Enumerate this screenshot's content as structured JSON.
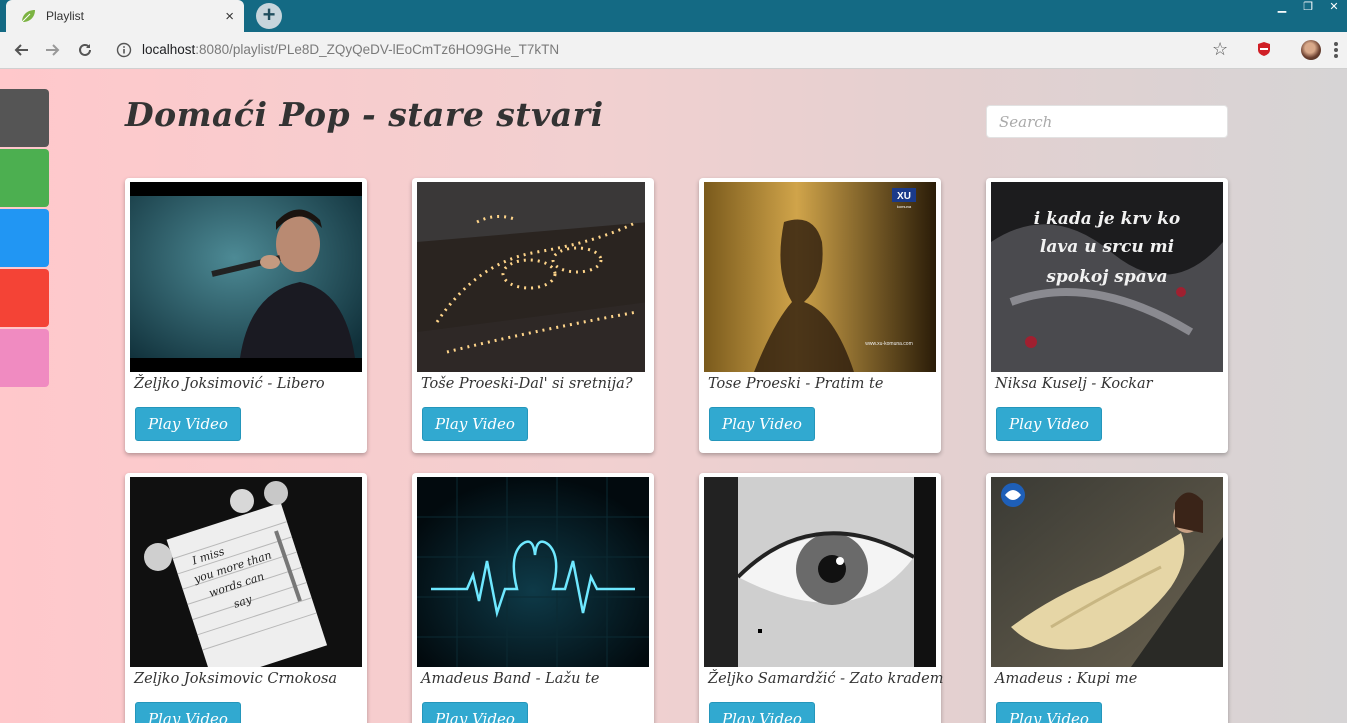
{
  "browser": {
    "tab_title": "Playlist",
    "tab_close": "×",
    "new_tab": "+",
    "url_host": "localhost",
    "url_rest": ":8080/playlist/PLe8D_ZQyQeDV-lEoCmTz6HO9GHe_T7kTN",
    "icons": {
      "favicon": "leaf-icon",
      "back": "back-arrow-icon",
      "forward": "forward-arrow-icon",
      "reload": "reload-icon",
      "info": "info-icon",
      "bookmark": "star-icon",
      "extension": "adblock-icon",
      "profile": "avatar",
      "menu": "kebab-menu-icon"
    }
  },
  "sidebar": {
    "swatches": [
      {
        "name": "dark",
        "color": "#555555"
      },
      {
        "name": "green",
        "color": "#4caf50"
      },
      {
        "name": "blue",
        "color": "#2196f3"
      },
      {
        "name": "red",
        "color": "#f44336"
      },
      {
        "name": "pink",
        "color": "#f08bc1"
      }
    ]
  },
  "header": {
    "title": "Domaći Pop - stare stvari",
    "search_placeholder": "Search"
  },
  "videos": [
    {
      "title": "Željko Joksimović - Libero",
      "button": "Play Video"
    },
    {
      "title": "Toše Proeski-Dal' si sretnija?",
      "button": "Play Video"
    },
    {
      "title": "Tose Proeski - Pratim te",
      "button": "Play Video"
    },
    {
      "title": "Niksa Kuselj - Kockar",
      "button": "Play Video"
    },
    {
      "title": "Zeljko Joksimovic Crnokosa",
      "button": "Play Video"
    },
    {
      "title": "Amadeus Band - Lažu te",
      "button": "Play Video"
    },
    {
      "title": "Željko Samardžić - Zato kradem",
      "button": "Play Video"
    },
    {
      "title": "Amadeus : Kupi me",
      "button": "Play Video"
    }
  ],
  "thumb_text": {
    "xu_logo": "XU",
    "xu_sub": "komuna",
    "xu_url": "www.xu-komuna.com",
    "lyric_line_1": "i kada je krv ko",
    "lyric_line_2": "lava u srcu mi",
    "lyric_line_3": "spokoj spava",
    "note_line_1": "I miss",
    "note_line_2": "you more than",
    "note_line_3": "words can",
    "note_line_4": "say"
  },
  "accent_color": "#31a9d0"
}
